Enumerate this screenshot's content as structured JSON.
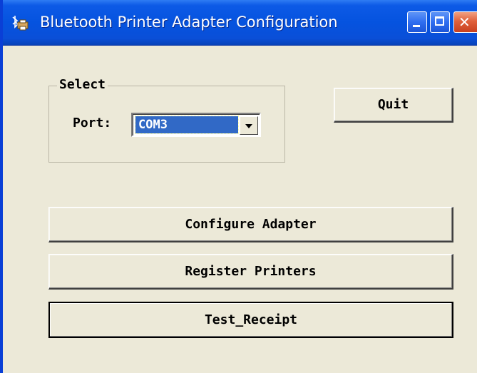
{
  "window": {
    "title": "Bluetooth Printer Adapter Configuration",
    "app_icon": "bluetooth-printer-icon"
  },
  "caption_buttons": {
    "minimize_icon": "minimize-icon",
    "maximize_icon": "maximize-icon",
    "close_icon": "close-icon",
    "close_glyph": "✕"
  },
  "select_group": {
    "title": "Select",
    "port_label": "Port:",
    "port_value": "COM3"
  },
  "buttons": {
    "quit": "Quit",
    "configure": "Configure Adapter",
    "register": "Register Printers",
    "test": "Test_Receipt"
  },
  "colors": {
    "titlebar": "#0553df",
    "dialog_bg": "#ece9d8",
    "selection": "#3169c6",
    "close_button": "#e0613c"
  }
}
